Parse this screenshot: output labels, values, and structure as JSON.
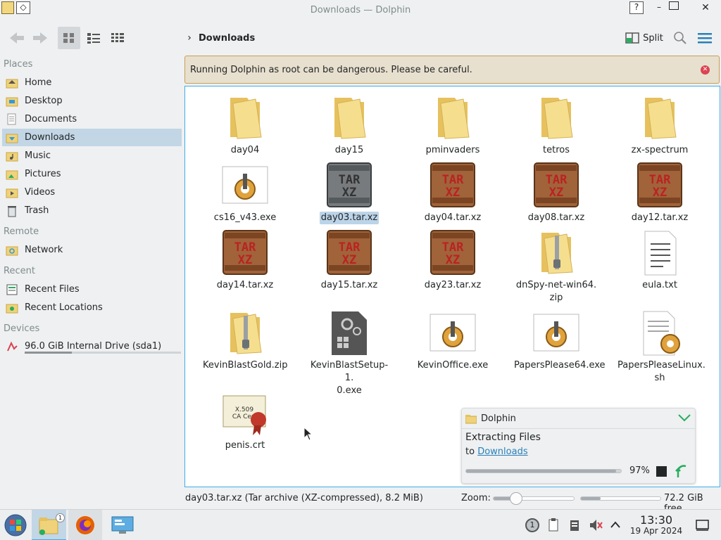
{
  "window": {
    "title": "Downloads — Dolphin"
  },
  "toolbar": {
    "breadcrumb": "Downloads",
    "split_label": "Split"
  },
  "sidebar": {
    "places_header": "Places",
    "places": [
      {
        "label": "Home",
        "icon": "home-folder-icon"
      },
      {
        "label": "Desktop",
        "icon": "desktop-folder-icon"
      },
      {
        "label": "Documents",
        "icon": "documents-folder-icon"
      },
      {
        "label": "Downloads",
        "icon": "downloads-folder-icon",
        "selected": true
      },
      {
        "label": "Music",
        "icon": "music-folder-icon"
      },
      {
        "label": "Pictures",
        "icon": "pictures-folder-icon"
      },
      {
        "label": "Videos",
        "icon": "videos-folder-icon"
      },
      {
        "label": "Trash",
        "icon": "trash-icon"
      }
    ],
    "remote_header": "Remote",
    "remote": [
      {
        "label": "Network",
        "icon": "network-icon"
      }
    ],
    "recent_header": "Recent",
    "recent": [
      {
        "label": "Recent Files",
        "icon": "recent-files-icon"
      },
      {
        "label": "Recent Locations",
        "icon": "recent-locations-icon"
      }
    ],
    "devices_header": "Devices",
    "devices": [
      {
        "label": "96.0 GiB Internal Drive (sda1)",
        "icon": "drive-icon",
        "usage_fraction": 0.3
      }
    ]
  },
  "warning": {
    "text": "Running Dolphin as root can be dangerous. Please be careful."
  },
  "files": [
    {
      "name": "day04",
      "type": "folder"
    },
    {
      "name": "day15",
      "type": "folder"
    },
    {
      "name": "pminvaders",
      "type": "folder"
    },
    {
      "name": "tetros",
      "type": "folder"
    },
    {
      "name": "zx-spectrum",
      "type": "folder"
    },
    {
      "name": "cs16_v43.exe",
      "type": "exe"
    },
    {
      "name": "day03.tar.xz",
      "type": "tarxz",
      "selected": true
    },
    {
      "name": "day04.tar.xz",
      "type": "tarxz"
    },
    {
      "name": "day08.tar.xz",
      "type": "tarxz"
    },
    {
      "name": "day12.tar.xz",
      "type": "tarxz"
    },
    {
      "name": "day14.tar.xz",
      "type": "tarxz"
    },
    {
      "name": "day15.tar.xz",
      "type": "tarxz"
    },
    {
      "name": "day23.tar.xz",
      "type": "tarxz"
    },
    {
      "name": "dnSpy-net-win64.\nzip",
      "type": "zip"
    },
    {
      "name": "eula.txt",
      "type": "txt"
    },
    {
      "name": "KevinBlastGold.zip",
      "type": "zip"
    },
    {
      "name": "KevinBlastSetup-1.\n0.exe",
      "type": "setup"
    },
    {
      "name": "KevinOffice.exe",
      "type": "exe"
    },
    {
      "name": "PapersPlease64.exe",
      "type": "exe"
    },
    {
      "name": "PapersPleaseLinux.\nsh",
      "type": "sh"
    },
    {
      "name": "penis.crt",
      "type": "crt"
    }
  ],
  "status": {
    "selection": "day03.tar.xz (Tar archive (XZ-compressed), 8.2 MiB)",
    "zoom_label": "Zoom:",
    "zoom_fraction": 0.28,
    "disk_used_fraction": 0.25,
    "free_space": "72.2 GiB free"
  },
  "notification": {
    "app": "Dolphin",
    "title": "Extracting Files",
    "to_prefix": "to",
    "to_link": "Downloads",
    "progress_fraction": 0.97,
    "percent": "97%"
  },
  "taskbar": {
    "time": "13:30",
    "date": "19 Apr 2024",
    "task_badge": "1",
    "tray_badge": "1"
  },
  "colors": {
    "accent": "#3daee9",
    "selection": "#c2d6e5",
    "warning_bg": "#e8e0ce",
    "folder": "#f0d27a"
  }
}
